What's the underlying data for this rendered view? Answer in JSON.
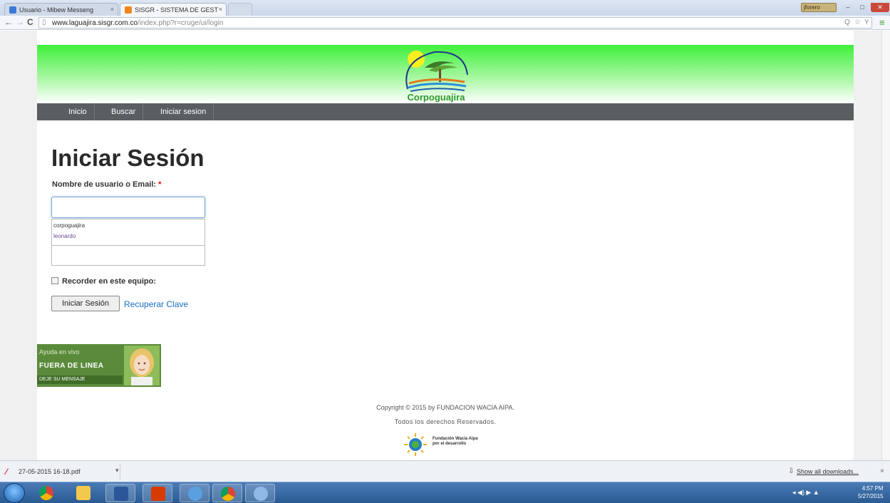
{
  "browser": {
    "tabs": [
      {
        "label": "Usuario - Mibew Messeng"
      },
      {
        "label": "SISGR - SISTEMA DE GEST"
      },
      {
        "label": ""
      }
    ],
    "window_user": "jforero",
    "url": {
      "host": "www.laguajira.sisgr.com.co",
      "path": "/index.php?r=cruge/ui/login"
    }
  },
  "site": {
    "logo_text": "Corpoguajira",
    "nav": [
      {
        "label": "Inicio"
      },
      {
        "label": "Buscar"
      },
      {
        "label": "Iniciar sesion"
      }
    ]
  },
  "login": {
    "title": "Iniciar Sesión",
    "user_label": "Nombre de usuario o Email:",
    "required_mark": "*",
    "username_value": "",
    "autocomplete": [
      "corpoguajira",
      "leonardo"
    ],
    "remember_label": "Recorder en este equipo:",
    "submit_label": "Iniciar Sesión",
    "recover_label": "Recuperar Clave"
  },
  "chat": {
    "line1": "Ayuda en vivo",
    "line2": "FUERA DE LINEA",
    "line3": "DEJE SU MENSAJE"
  },
  "footer": {
    "copyright": "Copyright © 2015 by FUNDACION WACIA AIPA.",
    "rights": "Todos los derechos Reservados.",
    "logo_text_1": "Fundación Wacia Aipa",
    "logo_text_2": "por el desarrollo"
  },
  "downloads": {
    "file_name": "27-05-2015 16-18.pdf",
    "show_all": "Show all downloads..."
  },
  "taskbar": {
    "time": "4:57 PM",
    "date": "5/27/2015"
  },
  "colors": {
    "banner_green": "#3ef03a",
    "nav_gray": "#595e61",
    "link_blue": "#1a6fc4",
    "chat_green": "#5a8b3b"
  }
}
